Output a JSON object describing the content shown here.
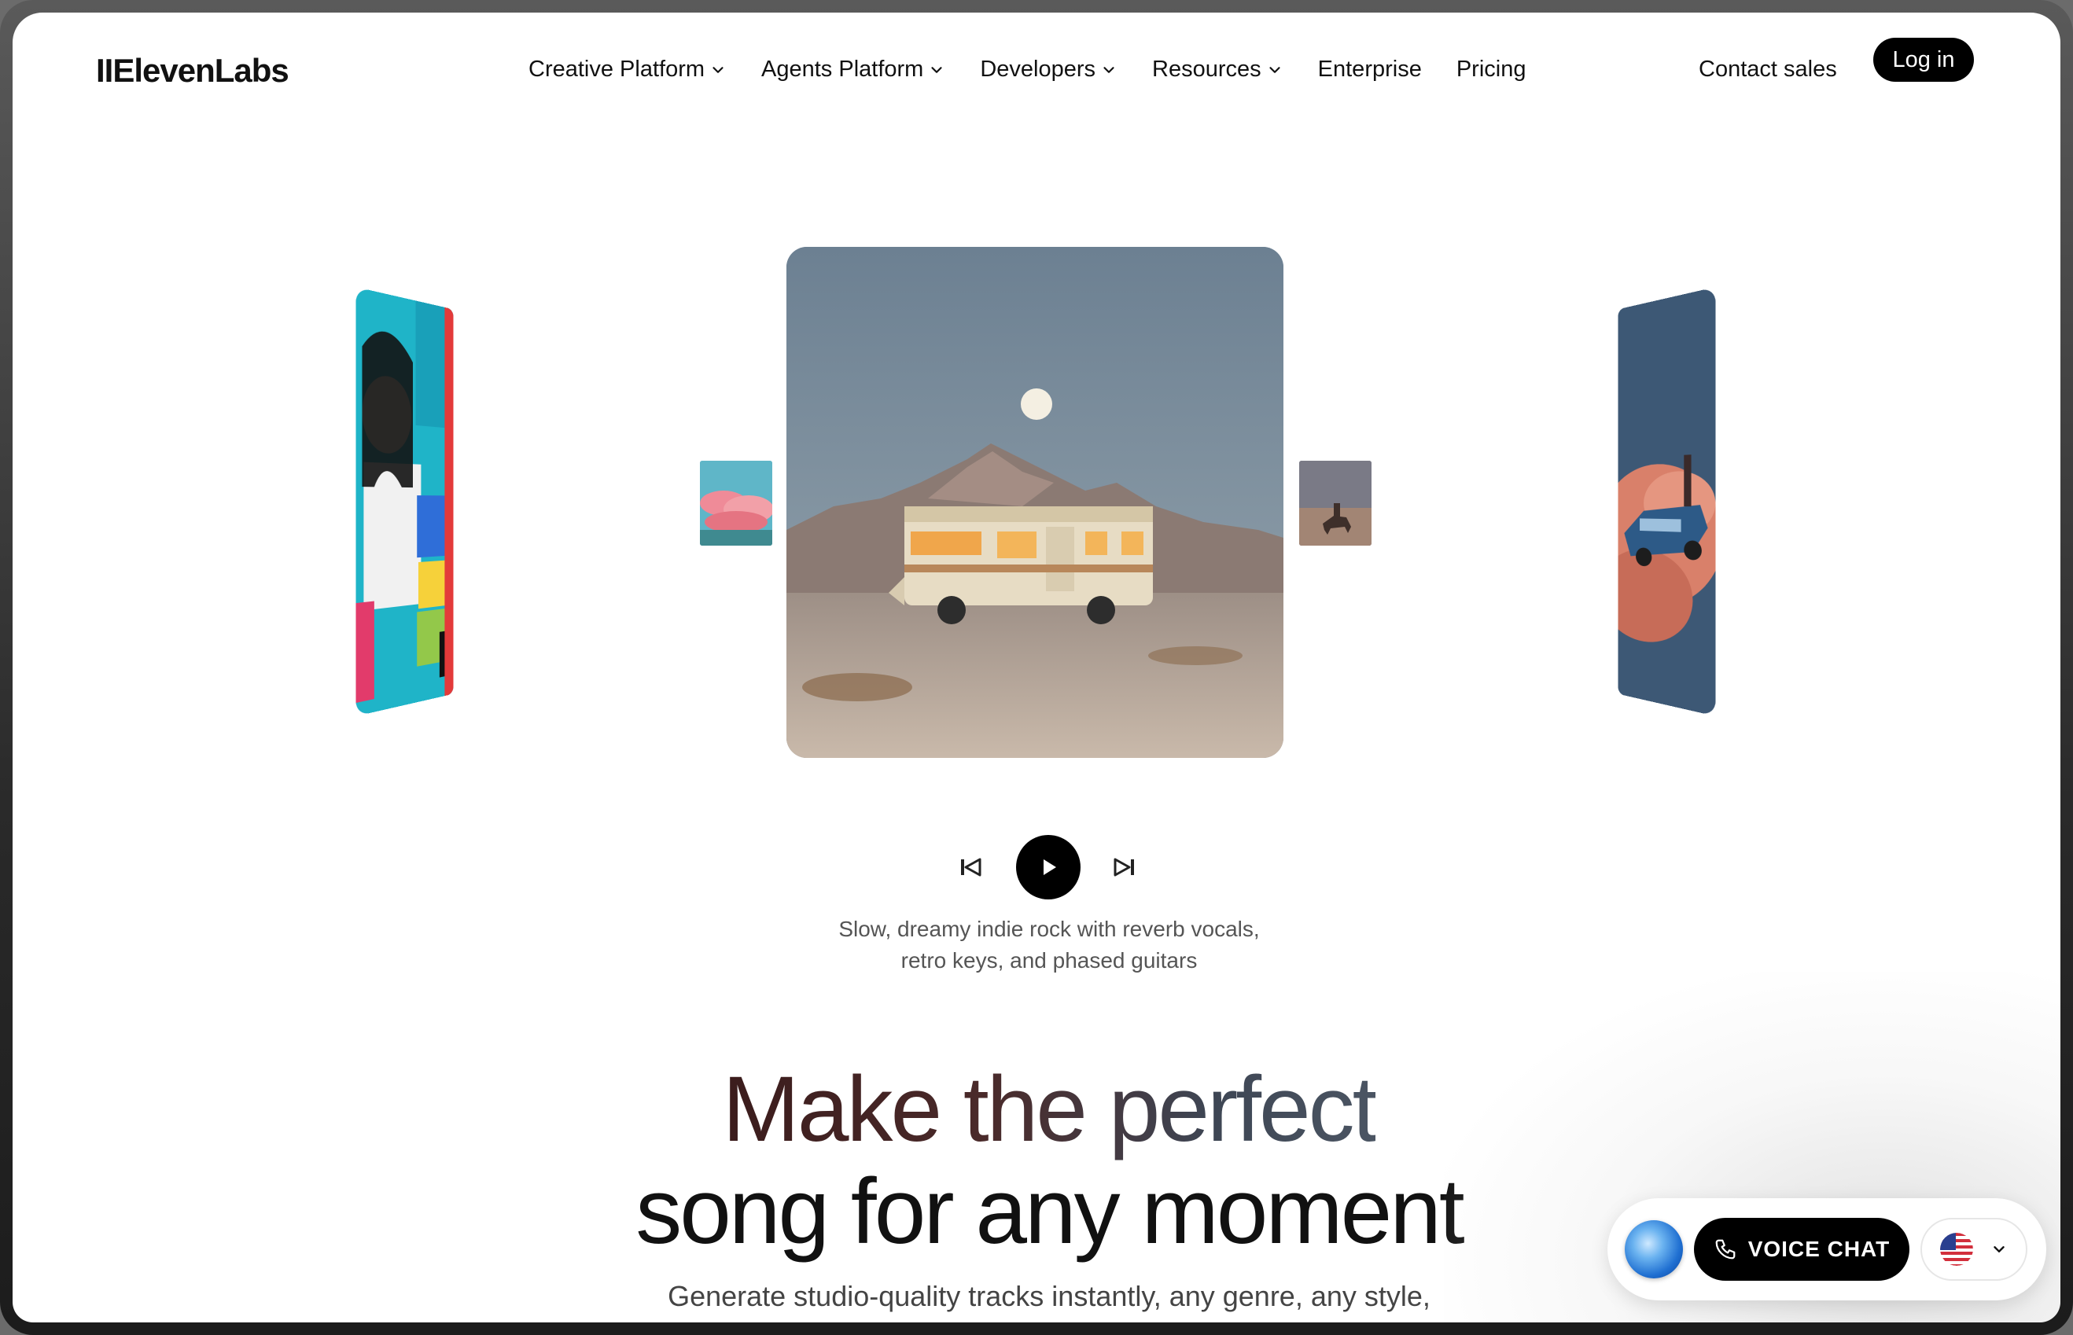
{
  "brand": {
    "logo_text": "IIElevenLabs"
  },
  "nav": {
    "items": [
      {
        "label": "Creative Platform",
        "has_dropdown": true
      },
      {
        "label": "Agents Platform",
        "has_dropdown": true
      },
      {
        "label": "Developers",
        "has_dropdown": true
      },
      {
        "label": "Resources",
        "has_dropdown": true
      },
      {
        "label": "Enterprise",
        "has_dropdown": false
      },
      {
        "label": "Pricing",
        "has_dropdown": false
      }
    ],
    "contact_label": "Contact sales",
    "login_label": "Log in"
  },
  "carousel": {
    "main_image_icon": "rv-desert-moon-image",
    "left_image_icon": "collage-woman-image",
    "right_image_icon": "car-on-cloud-image",
    "thumb_left_icon": "pink-clouds-image",
    "thumb_right_icon": "horse-rider-image"
  },
  "player": {
    "prev_icon": "skip-previous-icon",
    "play_icon": "play-icon",
    "next_icon": "skip-next-icon",
    "caption_line1": "Slow, dreamy indie rock with reverb vocals,",
    "caption_line2": "retro keys, and phased guitars"
  },
  "hero": {
    "line1": "Make the perfect",
    "line2": "song for any moment",
    "subtext": "Generate studio-quality tracks instantly, any genre, any style,"
  },
  "voice_chat": {
    "button_label": "VOICE CHAT",
    "orb_icon": "voice-orb-icon",
    "phone_icon": "phone-icon",
    "language_flag_icon": "us-flag-icon"
  },
  "colors": {
    "accent": "#000000",
    "hero_gradient_start": "#3b1c1c",
    "hero_gradient_end": "#4b5563",
    "caption": "#555555"
  }
}
